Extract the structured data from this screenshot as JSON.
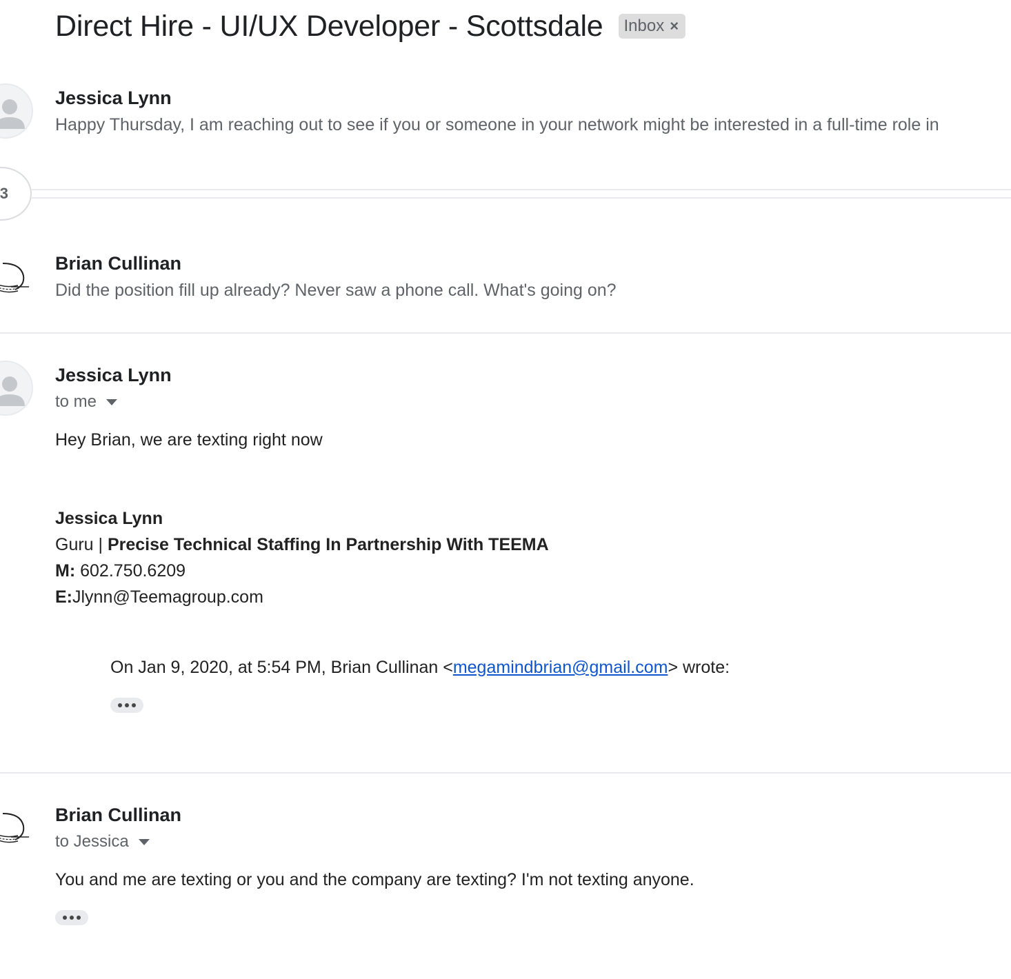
{
  "thread": {
    "subject": "Direct Hire - UI/UX Developer - Scottsdale",
    "label": "Inbox",
    "label_remove_glyph": "×",
    "collapsed_count": "3"
  },
  "messages": [
    {
      "sender": "Jessica Lynn",
      "snippet": "Happy Thursday, I am reaching out to see if you or someone in your network might be interested in a full-time role in",
      "avatar": "default-person-icon"
    },
    {
      "sender": "Brian Cullinan",
      "snippet": "Did the position fill up already? Never saw a phone call. What's going on?",
      "avatar": "sketch-avatar"
    },
    {
      "sender": "Jessica Lynn",
      "recipient": "to me",
      "avatar": "default-person-icon",
      "body": "Hey Brian, we are texting right now",
      "signature": {
        "name": "Jessica Lynn",
        "title_prefix": "Guru | ",
        "company": "Precise Technical Staffing In Partnership With TEEMA",
        "phone_label": "M:",
        "phone": " 602.750.6209",
        "email_label": "E:",
        "email": "Jlynn@Teemagroup.com"
      },
      "quote": {
        "prefix": "On Jan 9, 2020, at 5:54 PM, Brian Cullinan <",
        "link": "megamindbrian@gmail.com",
        "suffix": "> wrote:"
      }
    },
    {
      "sender": "Brian Cullinan",
      "recipient": "to Jessica",
      "avatar": "sketch-avatar",
      "body": "You and me are texting or you and the company are texting? I'm not texting anyone."
    }
  ],
  "colors": {
    "text": "#202124",
    "muted": "#5f6368",
    "link": "#1155cc",
    "chip_bg": "#dddddd",
    "divider": "#e8eaed"
  }
}
